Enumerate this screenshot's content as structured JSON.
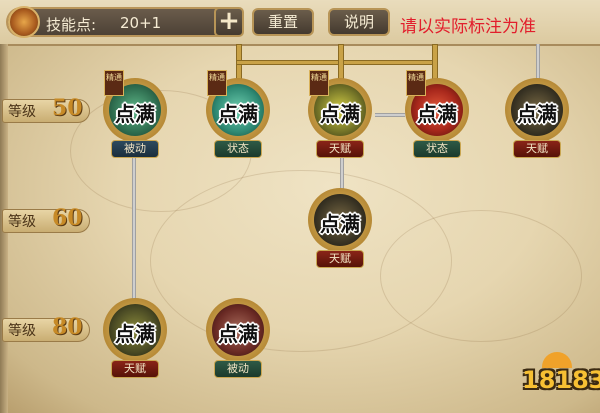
{
  "topbar": {
    "skill_points_label": "技能点:",
    "skill_points_value": "20+1",
    "plus_label": "+",
    "reset_label": "重置",
    "help_label": "说明",
    "notice": "请以实际标注为准"
  },
  "levels": [
    {
      "word": "等级",
      "num": "50"
    },
    {
      "word": "等级",
      "num": "60"
    },
    {
      "word": "等级",
      "num": "80"
    }
  ],
  "nodes": [
    {
      "status": "点满",
      "type": "被动",
      "elite": "精通",
      "color": "#3e8a64"
    },
    {
      "status": "点满",
      "type": "状态",
      "elite": "精通",
      "color": "#2f8a74"
    },
    {
      "status": "点满",
      "type": "天赋",
      "elite": "精通",
      "color": "#6a6a2a"
    },
    {
      "status": "点满",
      "type": "状态",
      "elite": "精通",
      "color": "#a8281c"
    },
    {
      "status": "点满",
      "type": "天赋",
      "elite": "",
      "color": "#3a3424"
    },
    {
      "status": "点满",
      "type": "天赋",
      "elite": "",
      "color": "#3a3424"
    },
    {
      "status": "点满",
      "type": "天赋",
      "elite": "",
      "color": "#4a4a24"
    },
    {
      "status": "点满",
      "type": "被动",
      "elite": "",
      "color": "#6a2a24"
    }
  ],
  "watermark": "18183",
  "colors": {
    "notice": "#e21e2c",
    "level_number": "#c78a26",
    "gold_ring": "#b78a36"
  }
}
